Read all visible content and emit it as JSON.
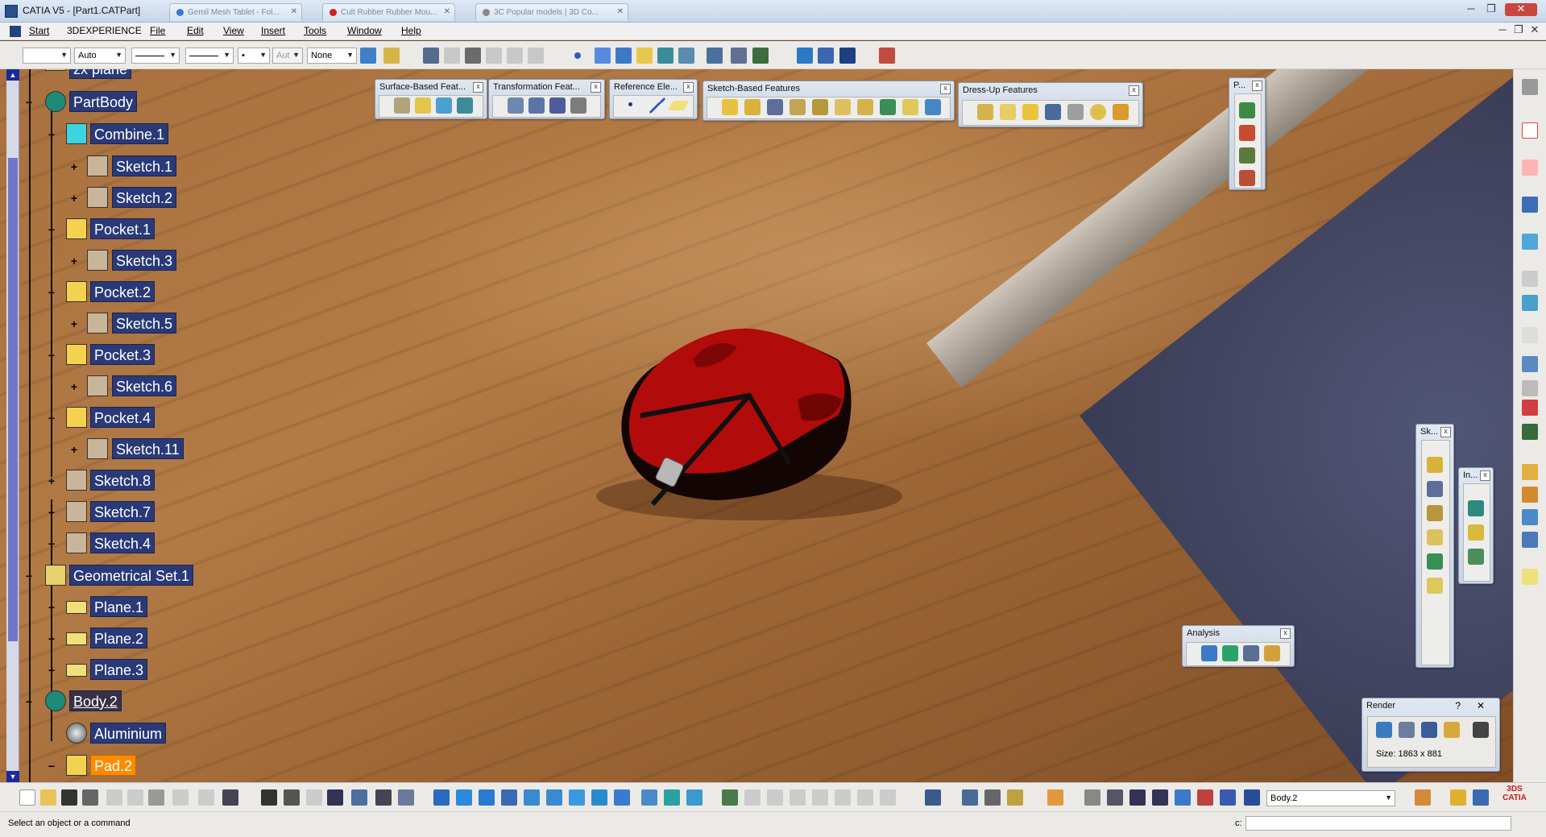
{
  "window": {
    "title": "CATIA V5 - [Part1.CATPart]",
    "browser_tabs": [
      "Gemil Mesh Tablet - Fol...",
      "Cult Rubber Rubber Mou...",
      "3C Popular models | 3D Co..."
    ]
  },
  "menu": {
    "items": [
      "Start",
      "3DEXPERIENCE",
      "File",
      "Edit",
      "View",
      "Insert",
      "Tools",
      "Window",
      "Help"
    ]
  },
  "toolbar_top": {
    "color_value": "",
    "layer_value": "Auto",
    "weight_value": "Aut",
    "none_value": "None"
  },
  "tree": {
    "partial_top": "zx plane",
    "part_body": "PartBody",
    "nodes": [
      {
        "label": "Combine.1",
        "icon": "combine-icon"
      },
      {
        "label": "Sketch.1",
        "icon": "sketch-icon"
      },
      {
        "label": "Sketch.2",
        "icon": "sketch-icon"
      },
      {
        "label": "Pocket.1",
        "icon": "pocket-icon"
      },
      {
        "label": "Sketch.3",
        "icon": "sketch-icon"
      },
      {
        "label": "Pocket.2",
        "icon": "pocket-icon"
      },
      {
        "label": "Sketch.5",
        "icon": "sketch-icon"
      },
      {
        "label": "Pocket.3",
        "icon": "pocket-icon"
      },
      {
        "label": "Sketch.6",
        "icon": "sketch-icon"
      },
      {
        "label": "Pocket.4",
        "icon": "pocket-icon"
      },
      {
        "label": "Sketch.11",
        "icon": "sketch-icon"
      },
      {
        "label": "Sketch.8",
        "icon": "sketch-icon"
      },
      {
        "label": "Sketch.7",
        "icon": "sketch-icon"
      },
      {
        "label": "Sketch.4",
        "icon": "sketch-icon"
      }
    ],
    "geo_set": "Geometrical Set.1",
    "planes": [
      "Plane.1",
      "Plane.2",
      "Plane.3"
    ],
    "body2": "Body.2",
    "aluminium": "Aluminium",
    "pad2": "Pad.2"
  },
  "floating": {
    "surface": "Surface-Based Feat...",
    "transform": "Transformation Feat...",
    "reference": "Reference Ele...",
    "sketch_based": "Sketch-Based Features",
    "dressup": "Dress-Up Features",
    "p_toolbar": "P...",
    "sk_toolbar": "Sk...",
    "in_toolbar": "In...",
    "analysis": "Analysis",
    "render_title": "Render",
    "render_help": "?",
    "render_close": "✕",
    "render_size": "Size: 1863 x 881"
  },
  "bottom": {
    "current_body": "Body.2",
    "status": "Select an object or a command",
    "cmd_label": "c:"
  },
  "colors": {
    "tree_node_bg": "#2a3a78",
    "tree_selected": "#ff8a00",
    "mouse_red": "#b10b0b",
    "wood": "#a8713f"
  }
}
